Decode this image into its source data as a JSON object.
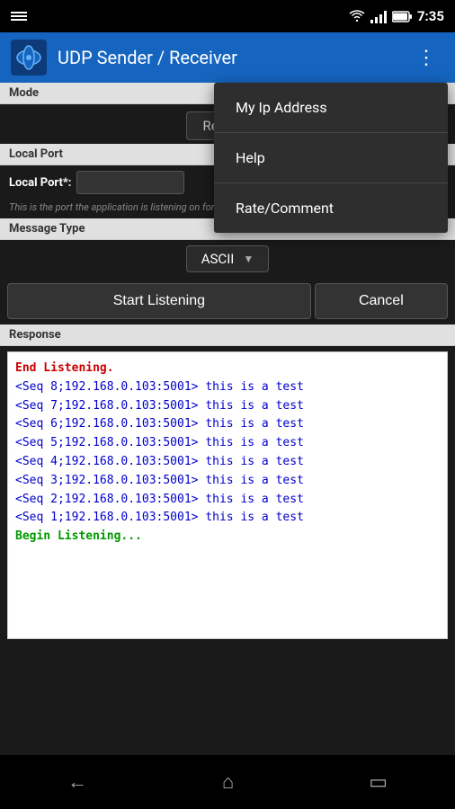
{
  "statusBar": {
    "time": "7:35"
  },
  "appBar": {
    "title": "UDP Sender / Receiver",
    "iconLabel": "🦈",
    "overflowLabel": "⋮"
  },
  "menu": {
    "items": [
      {
        "id": "my-ip",
        "label": "My Ip Address"
      },
      {
        "id": "help",
        "label": "Help"
      },
      {
        "id": "rate",
        "label": "Rate/Comment"
      }
    ]
  },
  "mode": {
    "sectionLabel": "Mode",
    "value": "Receiv..."
  },
  "localPort": {
    "sectionLabel": "Local Port",
    "fieldLabel": "Local Port*:",
    "value": "",
    "helpText": "This is the port the application is listening on for incoming datagrams (UDP pac..."
  },
  "messageType": {
    "sectionLabel": "Message Type",
    "value": "ASCII"
  },
  "buttons": {
    "startLabel": "Start Listening",
    "cancelLabel": "Cancel"
  },
  "response": {
    "sectionLabel": "Response",
    "endListening": "End Listening.",
    "lines": [
      "<Seq 8;192.168.0.103:5001> this is a test",
      "<Seq 7;192.168.0.103:5001> this is a test",
      "<Seq 6;192.168.0.103:5001> this is a test",
      "<Seq 5;192.168.0.103:5001> this is a test",
      "<Seq 4;192.168.0.103:5001> this is a test",
      "<Seq 3;192.168.0.103:5001> this is a test",
      "<Seq 2;192.168.0.103:5001> this is a test",
      "<Seq 1;192.168.0.103:5001> this is a test"
    ],
    "beginListening": "Begin Listening..."
  },
  "navBar": {
    "backLabel": "←",
    "homeLabel": "⌂",
    "recentsLabel": "▭"
  }
}
